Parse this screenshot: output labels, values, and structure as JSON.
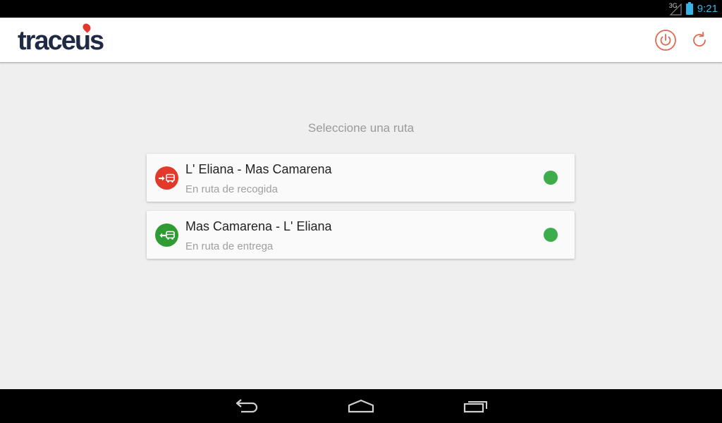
{
  "status_bar": {
    "network": "3G",
    "time": "9:21"
  },
  "app": {
    "logo_text": "traceus"
  },
  "main": {
    "prompt": "Seleccione una ruta",
    "routes": [
      {
        "title": "L' Eliana - Mas Camarena",
        "subtitle": "En ruta de recogida",
        "icon": "bus-outbound-arrow-icon",
        "icon_color": "#e2392b",
        "status_color": "#3cad4a"
      },
      {
        "title": "Mas Camarena - L' Eliana",
        "subtitle": "En ruta de entrega",
        "icon": "bus-inbound-arrow-icon",
        "icon_color": "#2e9c33",
        "status_color": "#3cad4a"
      }
    ]
  },
  "colors": {
    "accent": "#e2392b",
    "status_bar_text": "#33b5e5"
  }
}
